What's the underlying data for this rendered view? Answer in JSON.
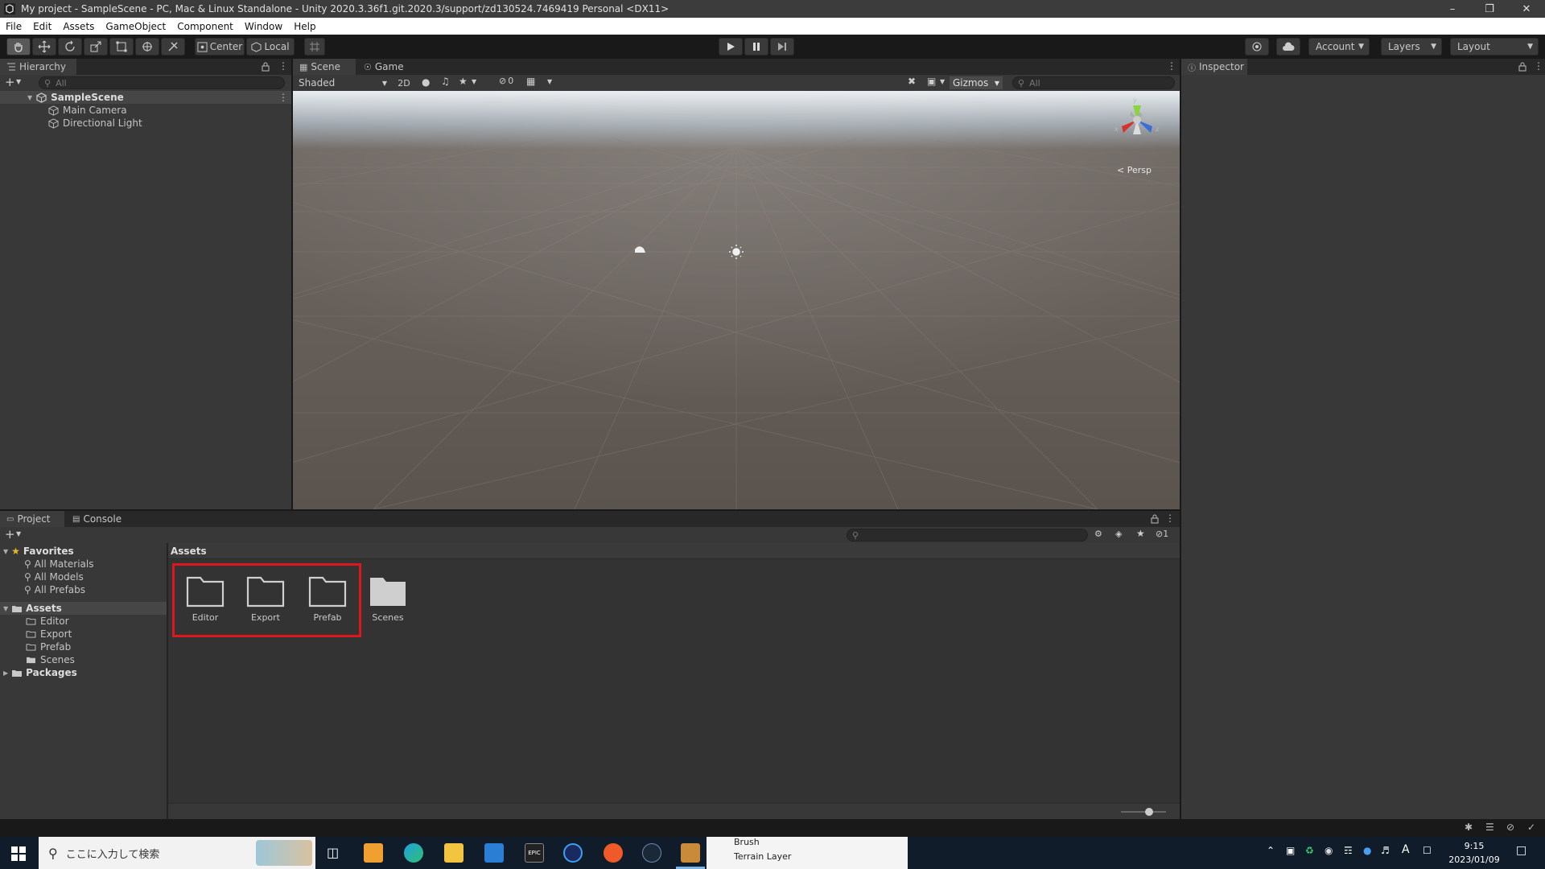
{
  "window": {
    "title": "My project - SampleScene - PC, Mac & Linux Standalone - Unity 2020.3.36f1.git.2020.3/support/zd130524.7469419 Personal <DX11>"
  },
  "menu": [
    "File",
    "Edit",
    "Assets",
    "GameObject",
    "Component",
    "Window",
    "Help"
  ],
  "toolbar": {
    "pivot_label": "Center",
    "space_label": "Local",
    "account_label": "Account",
    "layers_label": "Layers",
    "layout_label": "Layout"
  },
  "hierarchy": {
    "tab": "Hierarchy",
    "search_placeholder": "All",
    "scene": "SampleScene",
    "objects": [
      "Main Camera",
      "Directional Light"
    ]
  },
  "scene_view": {
    "tabs": [
      "Scene",
      "Game"
    ],
    "shading_mode": "Shaded",
    "mode_2d": "2D",
    "hidden_count": "0",
    "gizmos_label": "Gizmos",
    "search_placeholder": "All",
    "persp_label": "Persp",
    "axis_x": "x",
    "axis_y": "y",
    "axis_z": "z"
  },
  "inspector": {
    "tab": "Inspector"
  },
  "project": {
    "tabs": [
      "Project",
      "Console"
    ],
    "favorites_label": "Favorites",
    "favorites": [
      "All Materials",
      "All Models",
      "All Prefabs"
    ],
    "assets_label": "Assets",
    "asset_folders": [
      "Editor",
      "Export",
      "Prefab",
      "Scenes"
    ],
    "packages_label": "Packages",
    "breadcrumb": "Assets",
    "hidden_packages_count": "1",
    "highlight_color": "#e0161e"
  },
  "taskbar": {
    "search_placeholder": "ここに入力して検索",
    "epic_label": "EPIC",
    "popup_items": [
      "Brush",
      "Terrain Layer"
    ],
    "tray_letter": "A",
    "time": "9:15",
    "date": "2023/01/09"
  }
}
